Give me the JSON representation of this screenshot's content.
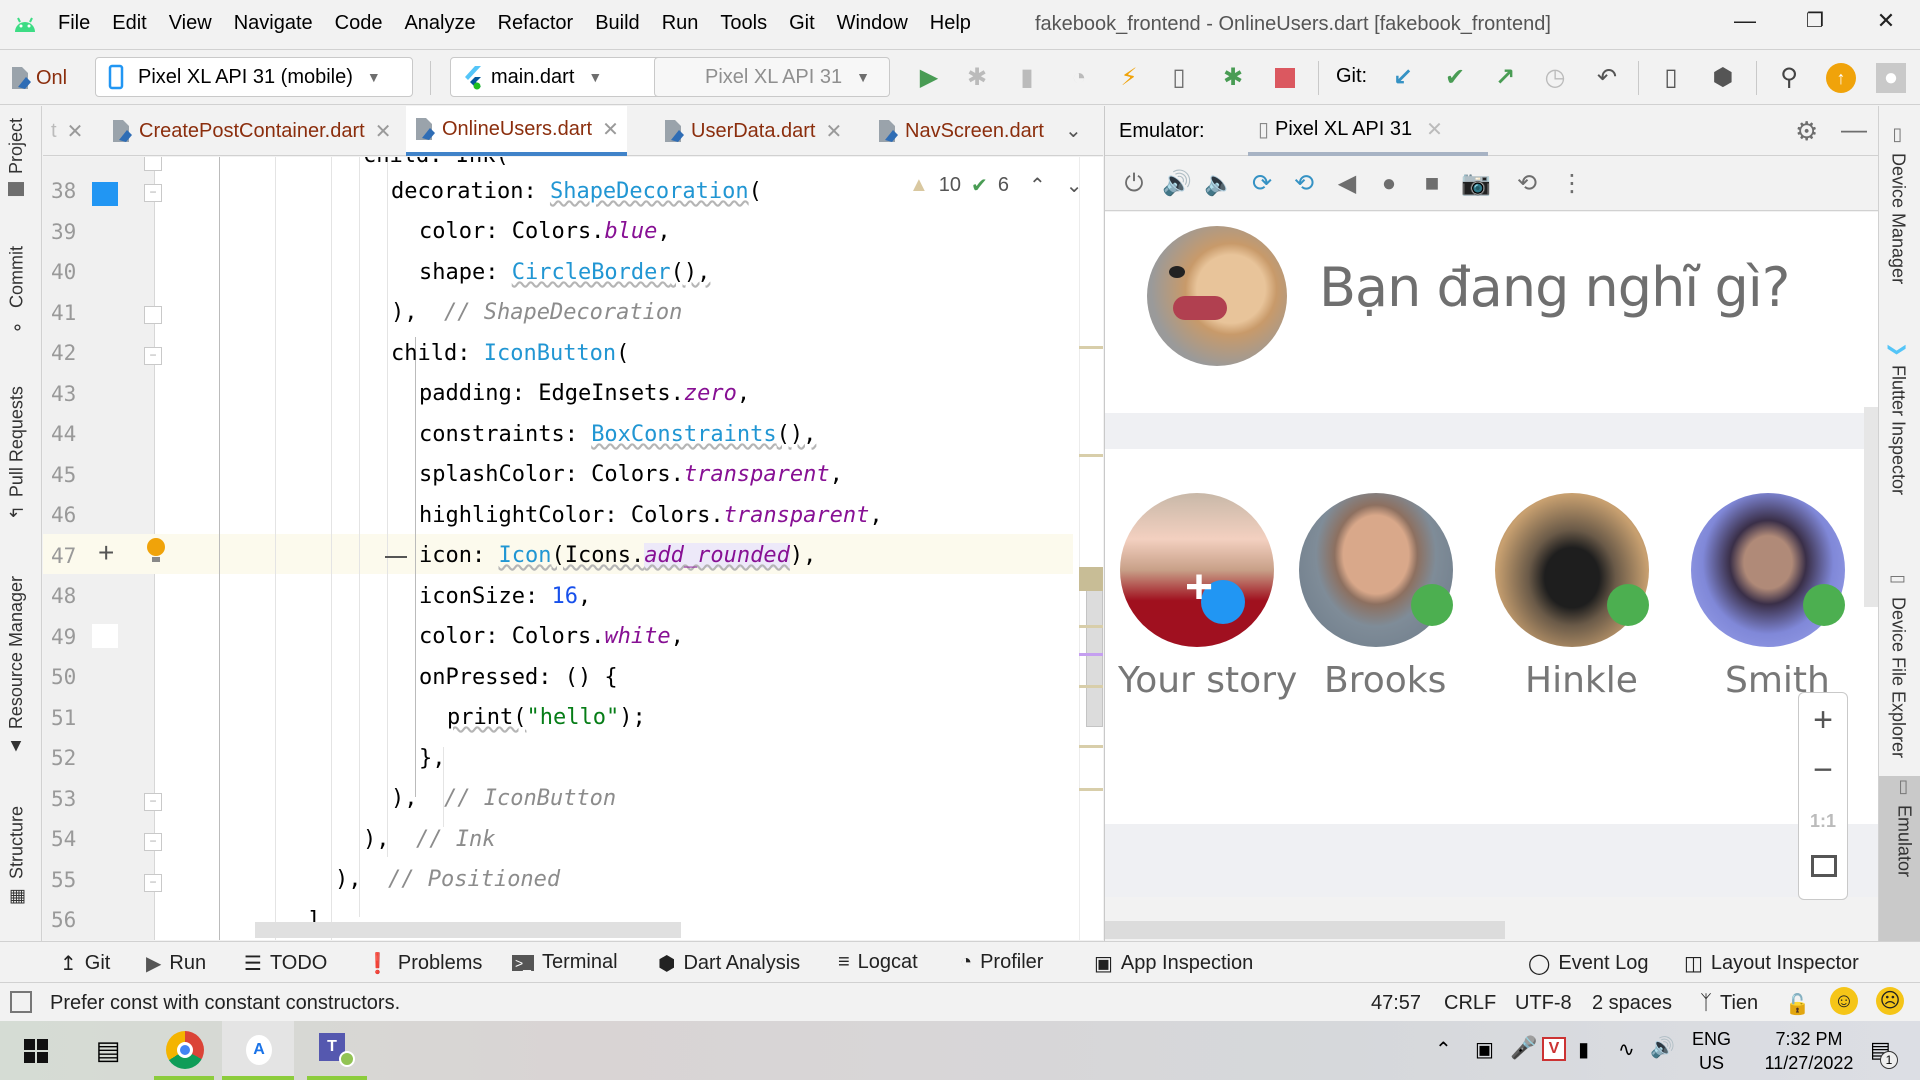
{
  "window": {
    "title": "fakebook_frontend - OnlineUsers.dart [fakebook_frontend]",
    "menu": [
      {
        "label": "File",
        "mnemonic": "F"
      },
      {
        "label": "Edit",
        "mnemonic": "E"
      },
      {
        "label": "View",
        "mnemonic": "V"
      },
      {
        "label": "Navigate",
        "mnemonic": "N"
      },
      {
        "label": "Code",
        "mnemonic": "C"
      },
      {
        "label": "Analyze",
        "mnemonic": "z"
      },
      {
        "label": "Refactor",
        "mnemonic": "R"
      },
      {
        "label": "Build",
        "mnemonic": "B"
      },
      {
        "label": "Run",
        "mnemonic": "u"
      },
      {
        "label": "Tools",
        "mnemonic": "T"
      },
      {
        "label": "Git",
        "mnemonic": "G"
      },
      {
        "label": "Window",
        "mnemonic": "W"
      },
      {
        "label": "Help",
        "mnemonic": "H"
      }
    ]
  },
  "toolbar": {
    "breadcrumb_short": "Onl",
    "device_select": "Pixel XL API 31 (mobile)",
    "run_config": "main.dart",
    "target_device": "Pixel XL API 31",
    "git_label": "Git:",
    "accent": "#f0a30a"
  },
  "left_tool_tabs": [
    "Project",
    "Commit",
    "Pull Requests",
    "Resource Manager",
    "Structure"
  ],
  "right_tool_tabs": [
    "Device Manager",
    "Flutter Inspector",
    "Device File Explorer",
    "Emulator"
  ],
  "editor_tabs": [
    {
      "label": "t",
      "partial": true
    },
    {
      "label": "CreatePostContainer.dart"
    },
    {
      "label": "OnlineUsers.dart",
      "active": true
    },
    {
      "label": "UserData.dart"
    },
    {
      "label": "NavScreen.dart"
    }
  ],
  "inspections": {
    "warnings": "10",
    "ok": "6"
  },
  "code": {
    "partial_top": "child: Ink(",
    "lines": [
      {
        "n": "38",
        "text": "decoration: ShapeDecoration("
      },
      {
        "n": "39",
        "text": "color: Colors.blue,",
        "swatch": "#2196f3"
      },
      {
        "n": "40",
        "text": "shape: CircleBorder(),"
      },
      {
        "n": "41",
        "text": "),  // ShapeDecoration"
      },
      {
        "n": "42",
        "text": "child: IconButton("
      },
      {
        "n": "43",
        "text": "padding: EdgeInsets.zero,"
      },
      {
        "n": "44",
        "text": "constraints: BoxConstraints(),"
      },
      {
        "n": "45",
        "text": "splashColor: Colors.transparent,"
      },
      {
        "n": "46",
        "text": "highlightColor: Colors.transparent,"
      },
      {
        "n": "47",
        "text": "icon: Icon(Icons.add_rounded),",
        "current": true
      },
      {
        "n": "48",
        "text": "iconSize: 16,"
      },
      {
        "n": "49",
        "text": "color: Colors.white,",
        "swatch": "#ffffff"
      },
      {
        "n": "50",
        "text": "onPressed: () {"
      },
      {
        "n": "51",
        "text": "print(\"hello\");"
      },
      {
        "n": "52",
        "text": "},"
      },
      {
        "n": "53",
        "text": "),  // IconButton"
      },
      {
        "n": "54",
        "text": "),  // Ink"
      },
      {
        "n": "55",
        "text": "),  // Positioned"
      },
      {
        "n": "56",
        "text": "],"
      }
    ],
    "tokens": {
      "l38a": "decoration: ",
      "l38b": "ShapeDecoration",
      "l38c": "(",
      "l39a": "color: Colors.",
      "l39b": "blue",
      "l39c": ",",
      "l40a": "shape: ",
      "l40b": "CircleBorder",
      "l40c": "(),",
      "l41a": "),  ",
      "l41b": "// ShapeDecoration",
      "l42a": "child: ",
      "l42b": "IconButton",
      "l42c": "(",
      "l43a": "padding: EdgeInsets.",
      "l43b": "zero",
      "l43c": ",",
      "l44a": "constraints: ",
      "l44b": "BoxConstraints",
      "l44c": "(),",
      "l45a": "splashColor: Colors.",
      "l45b": "transparent",
      "l45c": ",",
      "l46a": "highlightColor: Colors.",
      "l46b": "transparent",
      "l46c": ",",
      "l47a": "icon: ",
      "l47b": "Icon",
      "l47c": "(Icons.",
      "l47d": "add_rounded",
      "l47e": "),",
      "l48a": "iconSize: ",
      "l48b": "16",
      "l48c": ",",
      "l49a": "color: Colors.",
      "l49b": "white",
      "l49c": ",",
      "l50a": "onPressed: () {",
      "l51a": "print(",
      "l51b": "\"hello\"",
      "l51c": ");",
      "l52a": "},",
      "l53a": "),  ",
      "l53b": "// IconButton",
      "l54a": "),  ",
      "l54b": "// Ink",
      "l55a": "),  ",
      "l55b": "// Positioned",
      "l56a": "],"
    }
  },
  "emulator": {
    "label": "Emulator:",
    "tab": "Pixel XL API 31",
    "toolbar_icons": [
      "power-icon",
      "volume-up-icon",
      "volume-down-icon",
      "rotate-left-icon",
      "rotate-right-icon",
      "back-icon",
      "home-icon",
      "overview-icon",
      "screenshot-icon",
      "snapshot-icon",
      "more-icon"
    ],
    "app": {
      "post_prompt": "Bạn đang nghĩ gì?",
      "stories": [
        {
          "name": "Your story",
          "badge": "add"
        },
        {
          "name": "Brooks",
          "badge": "online"
        },
        {
          "name": "Hinkle",
          "badge": "online"
        },
        {
          "name": "Smith",
          "badge": "online"
        }
      ],
      "online_color": "#4caf50",
      "add_color": "#2196f3"
    },
    "zoom_controls": {
      "zoom_in": "+",
      "zoom_out": "−",
      "actual": "1:1"
    }
  },
  "bottom_tools": {
    "left": [
      "Git",
      "Run",
      "TODO",
      "Problems",
      "Terminal",
      "Dart Analysis",
      "Logcat",
      "Profiler",
      "App Inspection"
    ],
    "right": [
      "Event Log",
      "Layout Inspector"
    ]
  },
  "status": {
    "message": "Prefer const with constant constructors.",
    "position": "47:57",
    "line_sep": "CRLF",
    "encoding": "UTF-8",
    "indent": "2 spaces",
    "branch": "Tien"
  },
  "taskbar": {
    "lang_top": "ENG",
    "lang_bottom": "US",
    "time": "7:32 PM",
    "date": "11/27/2022",
    "notifications": "1"
  }
}
